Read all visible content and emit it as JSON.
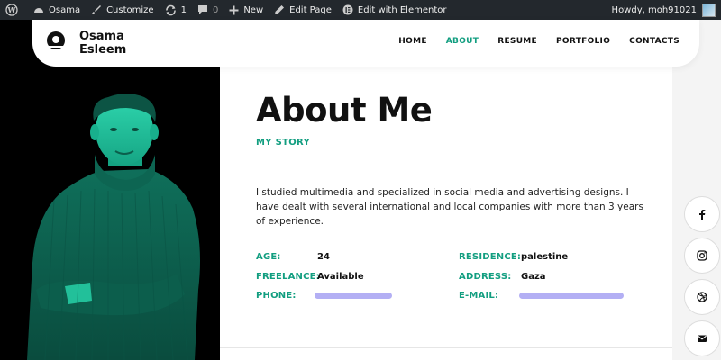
{
  "adminbar": {
    "site_name": "Osama",
    "customize": "Customize",
    "updates_count": "1",
    "comments_count": "0",
    "new_label": "New",
    "edit_page": "Edit Page",
    "edit_elementor": "Edit with Elementor",
    "howdy": "Howdy, moh91021"
  },
  "header": {
    "logo_line1": "Osama",
    "logo_line2": "Esleem",
    "nav": [
      "HOME",
      "ABOUT",
      "RESUME",
      "PORTFOLIO",
      "CONTACTS"
    ],
    "active_nav": "ABOUT"
  },
  "about": {
    "title": "About Me",
    "subtitle": "MY STORY",
    "bio": " I studied multimedia and specialized in social media and advertising designs. I have dealt with several international and local companies with more than 3 years of experience."
  },
  "info": {
    "age_label": "AGE:",
    "age_value": "24",
    "freelance_label": "FREELANCE:",
    "freelance_value": "Available",
    "phone_label": "PHONE:",
    "residence_label": "RESIDENCE:",
    "residence_value": "palestine",
    "address_label": "ADDRESS:",
    "address_value": "Gaza",
    "email_label": "E-MAIL:"
  },
  "social": [
    "facebook-icon",
    "instagram-icon",
    "dribbble-icon",
    "email-icon"
  ],
  "colors": {
    "accent": "#129e80",
    "adminbar": "#23282d"
  }
}
